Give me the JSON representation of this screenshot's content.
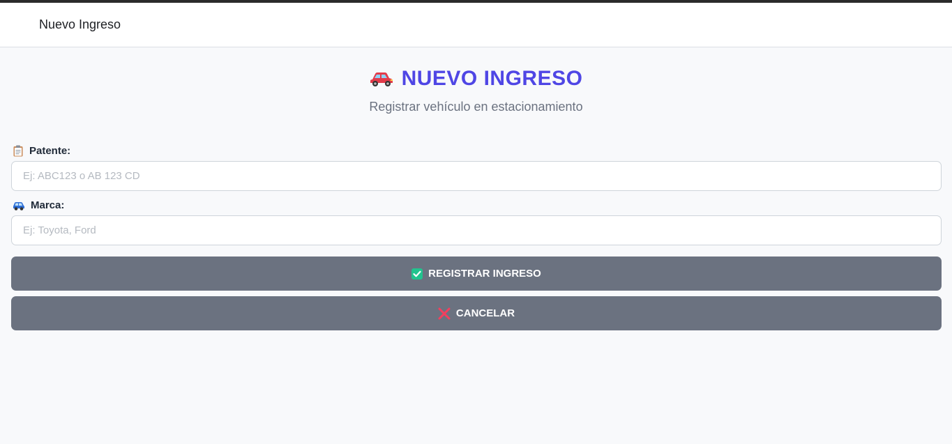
{
  "top_bar": {
    "title": "Nuevo Ingreso"
  },
  "header": {
    "title": "NUEVO INGRESO",
    "title_icon": "car-icon",
    "subtitle": "Registrar vehículo en estacionamiento"
  },
  "form": {
    "patente": {
      "icon": "clipboard-icon",
      "label": "Patente:",
      "placeholder": "Ej: ABC123 o AB 123 CD",
      "value": ""
    },
    "marca": {
      "icon": "suv-icon",
      "label": "Marca:",
      "placeholder": "Ej: Toyota, Ford",
      "value": ""
    }
  },
  "actions": {
    "register": {
      "icon": "check-box-icon",
      "label": "REGISTRAR INGRESO"
    },
    "cancel": {
      "icon": "cross-mark-icon",
      "label": "CANCELAR"
    }
  },
  "colors": {
    "accent": "#4f46e5",
    "button_bg": "#6b7280",
    "page_bg": "#f8f9fb",
    "check_green": "#22c38e",
    "cross_red": "#f43f5e"
  }
}
